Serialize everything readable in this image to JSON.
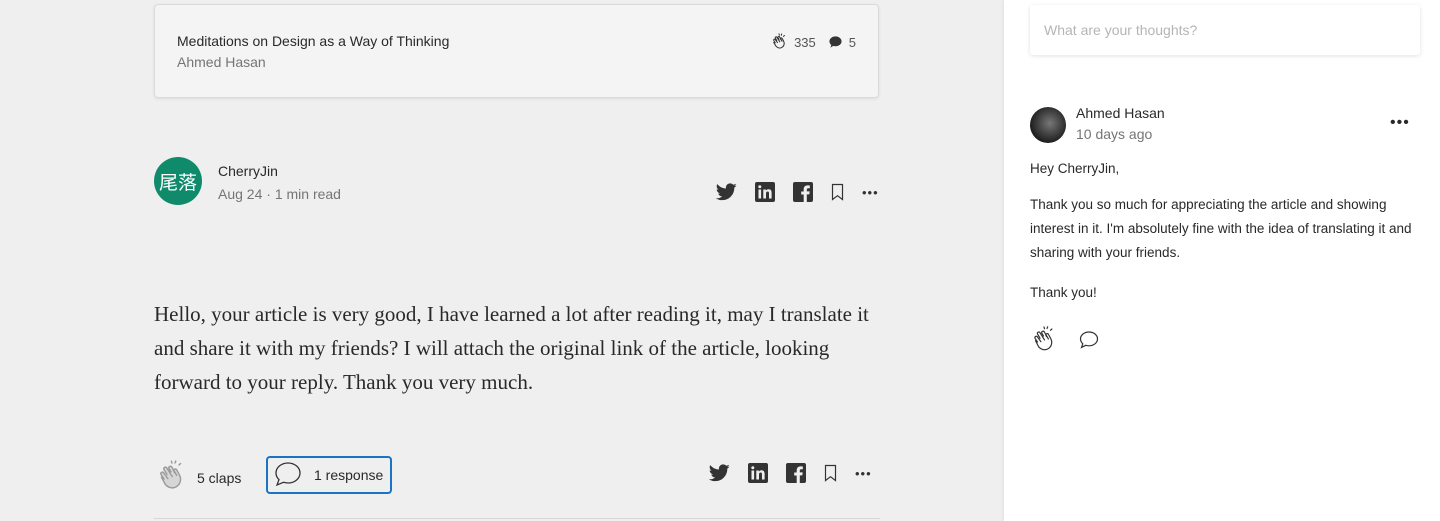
{
  "card": {
    "title": "Meditations on Design as a Way of Thinking",
    "author": "Ahmed Hasan",
    "claps": "335",
    "responses": "5"
  },
  "response": {
    "author_initials": "尾落",
    "author_name": "CherryJin",
    "meta": "Aug 24 · 1 min read",
    "body": "Hello, your article is very good, I have learned a lot after reading it, may I translate it and share it with my friends? I will attach the original link of the article, looking forward to your reply. Thank you very much.",
    "claps_label": "5 claps",
    "responses_label": "1 response",
    "more_label": "•••"
  },
  "panel": {
    "input_placeholder": "What are your thoughts?",
    "reply": {
      "author": "Ahmed Hasan",
      "time": "10 days ago",
      "more_label": "•••",
      "greeting": "Hey CherryJin,",
      "paragraph": "Thank you so much for appreciating the article and showing interest in it. I'm absolutely fine with the idea of translating it and sharing with your friends.",
      "thanks": "Thank you!"
    }
  },
  "colors": {
    "avatar_bg": "#0f8b6c",
    "focus_border": "#1a73c4"
  }
}
